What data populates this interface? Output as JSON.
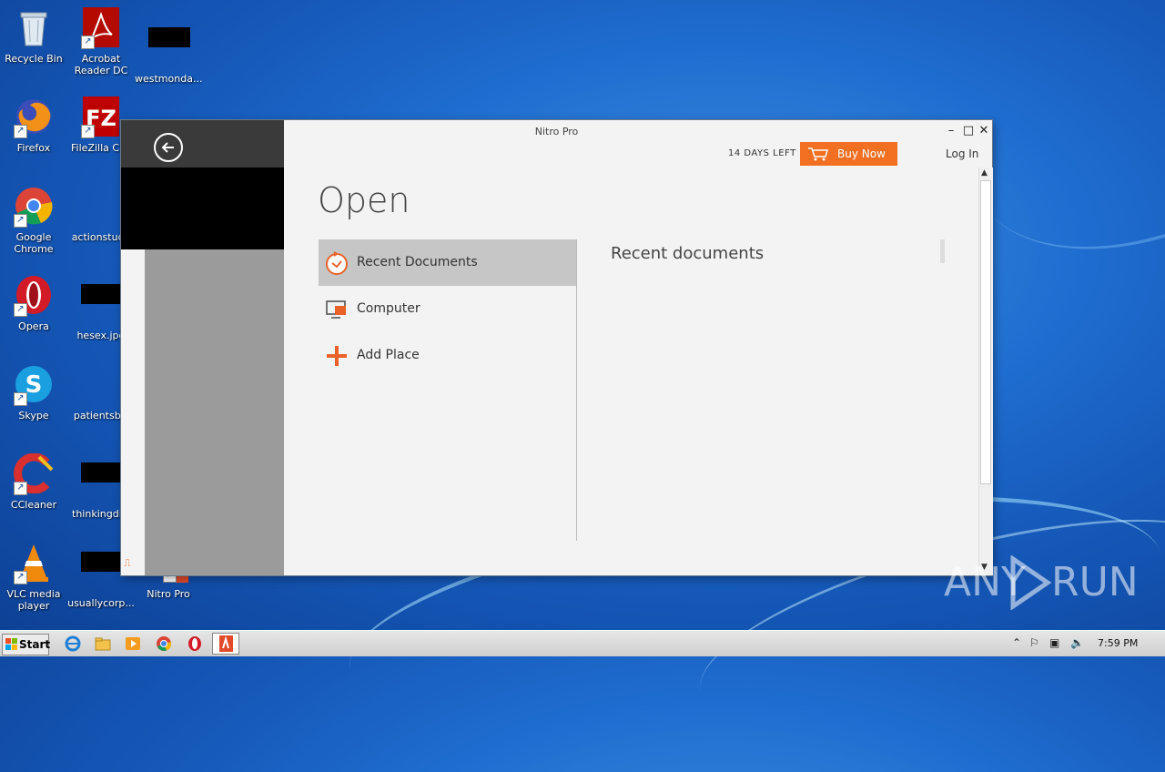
{
  "desktop": {
    "icons": [
      {
        "label": "Recycle Bin",
        "icon": "recycle-bin-icon"
      },
      {
        "label": "Acrobat\nReader DC",
        "icon": "acrobat-icon"
      },
      {
        "label": "westmonda...",
        "icon": "file-icon"
      },
      {
        "label": "Firefox",
        "icon": "firefox-icon"
      },
      {
        "label": "FileZilla Clie",
        "icon": "filezilla-icon"
      },
      {
        "label": "Google\nChrome",
        "icon": "chrome-icon"
      },
      {
        "label": "actionstude",
        "icon": "file-icon"
      },
      {
        "label": "Opera",
        "icon": "opera-icon"
      },
      {
        "label": "hesex.jpg",
        "icon": "file-icon"
      },
      {
        "label": "Skype",
        "icon": "skype-icon"
      },
      {
        "label": "patientsby.",
        "icon": "file-icon"
      },
      {
        "label": "CCleaner",
        "icon": "ccleaner-icon"
      },
      {
        "label": "thinkingdis.",
        "icon": "file-icon"
      },
      {
        "label": "VLC media\nplayer",
        "icon": "vlc-icon"
      },
      {
        "label": "usuallycorp...",
        "icon": "file-icon"
      },
      {
        "label": "Nitro Pro",
        "icon": "nitro-icon"
      }
    ]
  },
  "window": {
    "title": "Nitro Pro",
    "trial_text": "14 DAYS LEFT",
    "buy_label": "Buy Now",
    "login_label": "Log In",
    "heading": "Open",
    "nav": [
      {
        "label": "Recent Documents",
        "icon": "clock-icon"
      },
      {
        "label": "Computer",
        "icon": "computer-icon"
      },
      {
        "label": "Add Place",
        "icon": "plus-icon"
      }
    ],
    "recent_heading": "Recent documents"
  },
  "taskbar": {
    "start_label": "Start",
    "clock": "7:59 PM"
  },
  "watermark": {
    "left": "ANY",
    "right": "RUN"
  },
  "colors": {
    "accent": "#f36f21",
    "sidebar_dark": "#3a3a3a",
    "selected": "#c6c6c6"
  }
}
